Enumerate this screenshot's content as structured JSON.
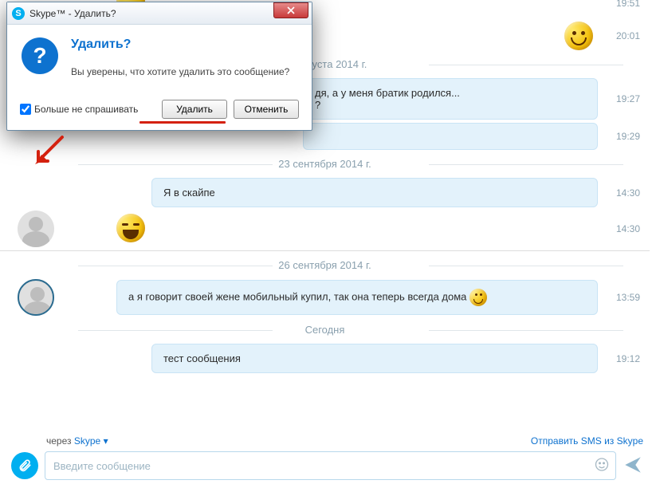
{
  "dialog": {
    "title": "Skype™ - Удалить?",
    "heading": "Удалить?",
    "body_text": "Вы уверены, что хотите удалить это сообщение?",
    "checkbox_label": "Больше не спрашивать",
    "btn_delete": "Удалить",
    "btn_cancel": "Отменить"
  },
  "messages": [
    {
      "type": "emoji_row",
      "emoji": "laugh",
      "time": "19:51"
    },
    {
      "type": "emoji_only_right",
      "emoji": "smile",
      "time": "20:01"
    },
    {
      "type": "date",
      "label": "21 августа 2014 г."
    },
    {
      "type": "bubble",
      "text": "дя, а у меня братик родился...\n?",
      "time": "19:27",
      "truncated_left": true
    },
    {
      "type": "bubble",
      "text": "",
      "time": "19:29",
      "truncated_left": true
    },
    {
      "type": "date",
      "label": "23 сентября 2014 г."
    },
    {
      "type": "bubble",
      "text": "Я в скайпе",
      "time": "14:30",
      "indent": true
    },
    {
      "type": "avatar_emoji",
      "emoji": "laugh",
      "time": "14:30"
    },
    {
      "type": "date",
      "label": "26 сентября 2014 г."
    },
    {
      "type": "bubble_avatar",
      "text": "а я говорит своей жене мобильный купил, так она теперь всегда дома ",
      "inline_emoji": "smile",
      "time": "13:59"
    },
    {
      "type": "date",
      "label": "Сегодня"
    },
    {
      "type": "bubble",
      "text": "тест сообщения",
      "time": "19:12",
      "indent": true
    }
  ],
  "input": {
    "via_prefix": "через ",
    "via_link": "Skype",
    "sms_link": "Отправить SMS из Skype",
    "placeholder": "Введите сообщение"
  }
}
